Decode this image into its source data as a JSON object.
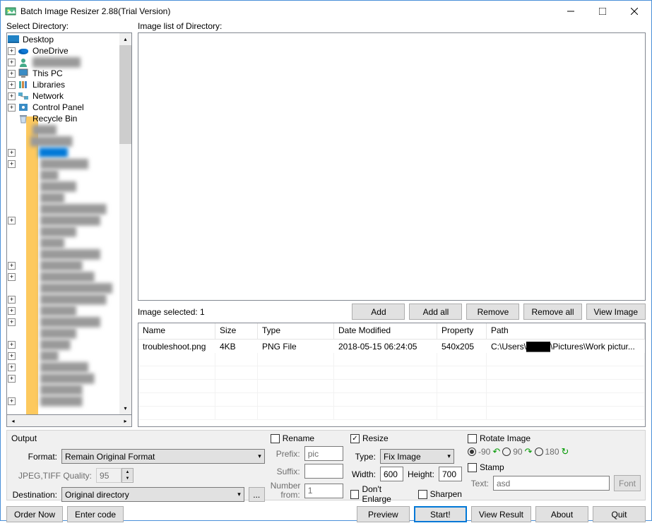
{
  "window": {
    "title": "Batch Image Resizer 2.88(Trial Version)"
  },
  "labels": {
    "select_dir": "Select Directory:",
    "image_list": "Image list of Directory:",
    "image_selected": "Image selected: 1",
    "output": "Output",
    "format": "Format:",
    "jpeg_quality": "JPEG,TIFF Quality:",
    "destination": "Destination:",
    "prefix": "Prefix:",
    "suffix": "Suffix:",
    "number_from": "Number from:",
    "rename": "Rename",
    "resize": "Resize",
    "type": "Type:",
    "width": "Width:",
    "height": "Height:",
    "dont_enlarge": "Don't Enlarge",
    "sharpen": "Sharpen",
    "rotate": "Rotate Image",
    "stamp": "Stamp",
    "text": "Text:",
    "rot_m90": "-90",
    "rot_90": "90",
    "rot_180": "180"
  },
  "tree": {
    "desktop": "Desktop",
    "onedrive": "OneDrive",
    "user": "████████",
    "thispc": "This PC",
    "libraries": "Libraries",
    "network": "Network",
    "controlpanel": "Control Panel",
    "recyclebin": "Recycle Bin"
  },
  "buttons": {
    "add": "Add",
    "add_all": "Add all",
    "remove": "Remove",
    "remove_all": "Remove all",
    "view_image": "View Image",
    "order_now": "Order Now",
    "enter_code": "Enter code",
    "preview": "Preview",
    "start": "Start!",
    "view_result": "View Result",
    "about": "About",
    "quit": "Quit",
    "font": "Font",
    "browse": "..."
  },
  "table": {
    "headers": {
      "name": "Name",
      "size": "Size",
      "type": "Type",
      "date": "Date Modified",
      "property": "Property",
      "path": "Path"
    },
    "rows": [
      {
        "name": "troubleshoot.png",
        "size": "4KB",
        "type": "PNG File",
        "date": "2018-05-15 06:24:05",
        "property": "540x205",
        "path": "C:\\Users\\████\\Pictures\\Work pictur..."
      }
    ]
  },
  "values": {
    "format": "Remain Original Format",
    "quality": "95",
    "destination": "Original directory",
    "prefix": "pic",
    "suffix": "",
    "number_from": "1",
    "resize_type": "Fix Image",
    "width": "600",
    "height": "700",
    "stamp_text": "asd"
  }
}
